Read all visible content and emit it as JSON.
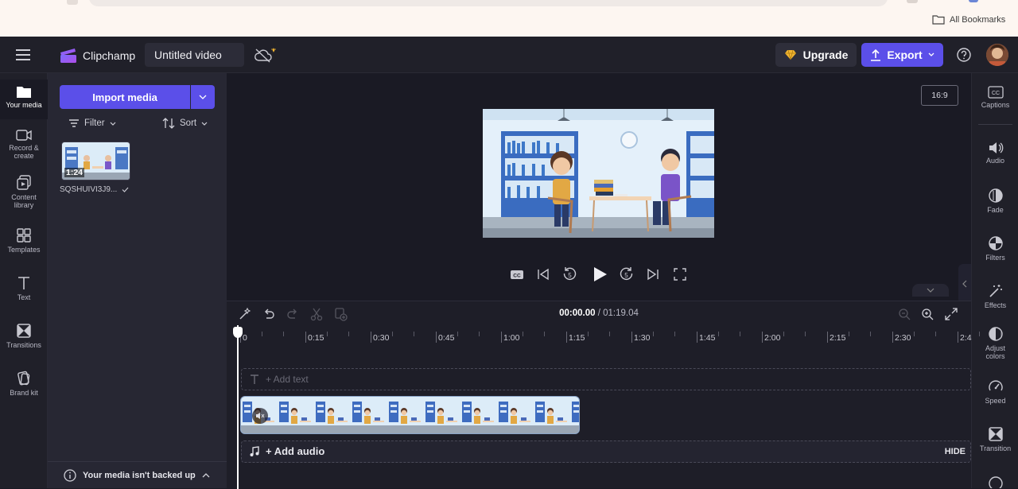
{
  "browser": {
    "bookmarks_label": "All Bookmarks"
  },
  "app": {
    "name": "Clipchamp",
    "project_title": "Untitled video",
    "upgrade_label": "Upgrade",
    "export_label": "Export",
    "accent": "#5b4fe9",
    "premium_color": "#f2b531"
  },
  "left_nav": {
    "items": [
      {
        "label": "Your media"
      },
      {
        "label": "Record &\ncreate"
      },
      {
        "label": "Content\nlibrary"
      },
      {
        "label": "Templates"
      },
      {
        "label": "Text"
      },
      {
        "label": "Transitions"
      },
      {
        "label": "Brand kit"
      }
    ]
  },
  "media_panel": {
    "import_label": "Import media",
    "filter_label": "Filter",
    "sort_label": "Sort",
    "asset": {
      "duration": "1:24",
      "name": "SQSHUIVI3J9..."
    },
    "backup_notice": "Your media isn't backed up"
  },
  "preview": {
    "aspect_ratio": "16:9"
  },
  "right_nav": {
    "items": [
      {
        "label": "Captions"
      },
      {
        "label": "Audio"
      },
      {
        "label": "Fade"
      },
      {
        "label": "Filters"
      },
      {
        "label": "Effects"
      },
      {
        "label": "Adjust\ncolors"
      },
      {
        "label": "Speed"
      },
      {
        "label": "Transition"
      }
    ]
  },
  "timeline": {
    "current_time": "00:00.00",
    "separator": " / ",
    "total_time": "01:19.04",
    "ruler": [
      "0",
      "0:15",
      "0:30",
      "0:45",
      "1:00",
      "1:15",
      "1:30",
      "1:45",
      "2:00",
      "2:15",
      "2:30",
      "2:4"
    ],
    "add_text_label": "+ Add text",
    "add_audio_label": "+ Add audio",
    "hide_label": "HIDE"
  }
}
